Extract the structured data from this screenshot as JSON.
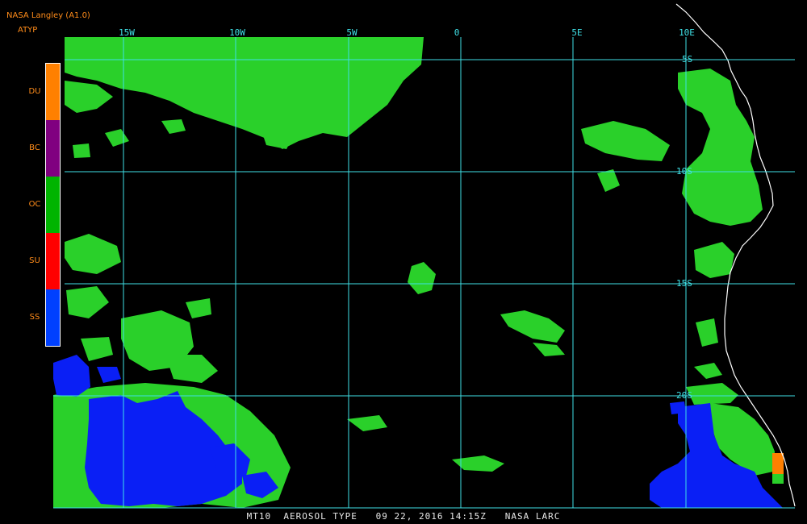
{
  "header": {
    "app_title": "NASA Langley (A1.0)",
    "product_code": "ATYP"
  },
  "legend": {
    "items": [
      {
        "code": "DU",
        "color": "#ff8000"
      },
      {
        "code": "BC",
        "color": "#800080"
      },
      {
        "code": "OC",
        "color": "#00b400"
      },
      {
        "code": "SU",
        "color": "#ff0000"
      },
      {
        "code": "SS",
        "color": "#0040ff"
      }
    ]
  },
  "map": {
    "longitude_labels": [
      "15W",
      "10W",
      "5W",
      "0",
      "5E",
      "10E"
    ],
    "latitude_labels": [
      "5S",
      "10S",
      "15S",
      "20S"
    ],
    "colors": {
      "grid": "#3fe0e6",
      "coastline": "#ffffff",
      "OC": "#2ad02a",
      "SS": "#0a1ff5",
      "DU": "#ff8000"
    }
  },
  "footer": {
    "caption": "MT10  AEROSOL TYPE   09 22, 2016 14:15Z   NASA LARC"
  }
}
